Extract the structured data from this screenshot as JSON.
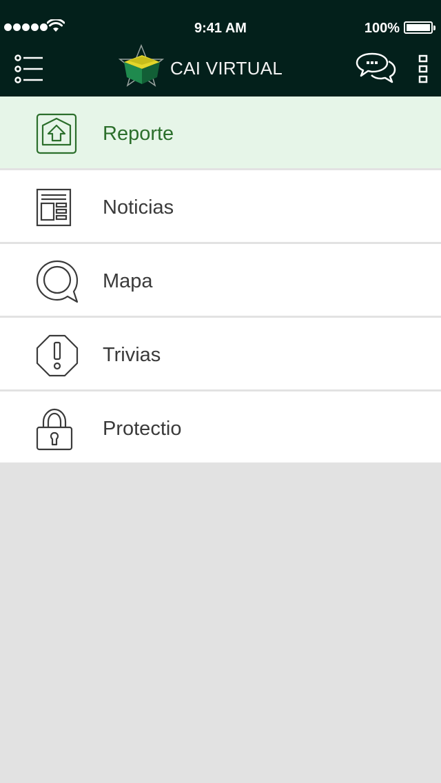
{
  "status_bar": {
    "time": "9:41 AM",
    "battery": "100%",
    "signal_bars": 5,
    "battery_level": 1.0
  },
  "header": {
    "title": "CAI VIRTUAL",
    "menu_icon": "list-menu-icon",
    "logo_icon": "cai-star-logo-icon",
    "chat_icon": "chat-bubbles-icon",
    "more_icon": "more-vertical-icon"
  },
  "menu": {
    "items": [
      {
        "label": "Reporte",
        "icon": "home-upload-icon",
        "active": true
      },
      {
        "label": "Noticias",
        "icon": "newspaper-icon",
        "active": false
      },
      {
        "label": "Mapa",
        "icon": "map-search-bubble-icon",
        "active": false
      },
      {
        "label": "Trivias",
        "icon": "octagon-alert-icon",
        "active": false
      },
      {
        "label": "Protectio",
        "icon": "padlock-icon",
        "active": false
      }
    ]
  },
  "colors": {
    "header_bg": "#03201b",
    "active_bg": "#e6f5e8",
    "active_text": "#2b6e2b",
    "text": "#3a3a3a",
    "page_bg": "#e2e2e2",
    "accent_green": "#1e6b3a",
    "accent_yellow": "#d9cf1a"
  }
}
